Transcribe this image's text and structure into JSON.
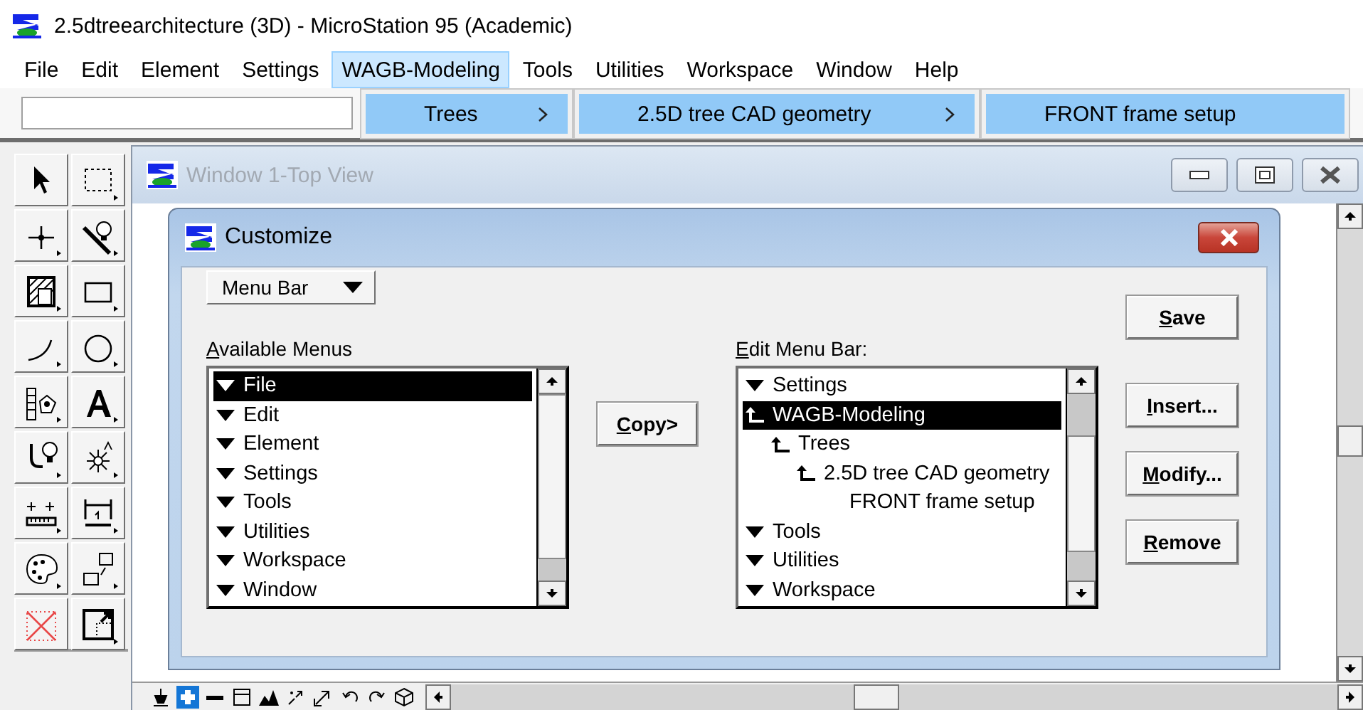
{
  "app": {
    "title": "2.5dtreearchitecture (3D) - MicroStation 95 (Academic)"
  },
  "menubar": [
    {
      "label": "File",
      "selected": false
    },
    {
      "label": "Edit",
      "selected": false
    },
    {
      "label": "Element",
      "selected": false
    },
    {
      "label": "Settings",
      "selected": false
    },
    {
      "label": "WAGB-Modeling",
      "selected": true
    },
    {
      "label": "Tools",
      "selected": false
    },
    {
      "label": "Utilities",
      "selected": false
    },
    {
      "label": "Workspace",
      "selected": false
    },
    {
      "label": "Window",
      "selected": false
    },
    {
      "label": "Help",
      "selected": false
    }
  ],
  "cascade": [
    {
      "label": "Trees",
      "has_submenu": true
    },
    {
      "label": "2.5D tree CAD geometry",
      "has_submenu": true
    },
    {
      "label": "FRONT frame setup",
      "has_submenu": false
    }
  ],
  "view_window": {
    "title": "Window 1-Top View",
    "active": false
  },
  "dialog": {
    "title": "Customize",
    "mnemonics": true,
    "dropdown": "Menu Bar",
    "available": {
      "label": "Available Menus",
      "items": [
        {
          "label": "File",
          "kind": "menu",
          "selected": true
        },
        {
          "label": "Edit",
          "kind": "menu",
          "selected": false
        },
        {
          "label": "Element",
          "kind": "menu",
          "selected": false
        },
        {
          "label": "Settings",
          "kind": "menu",
          "selected": false
        },
        {
          "label": "Tools",
          "kind": "menu",
          "selected": false
        },
        {
          "label": "Utilities",
          "kind": "menu",
          "selected": false
        },
        {
          "label": "Workspace",
          "kind": "menu",
          "selected": false
        },
        {
          "label": "Window",
          "kind": "menu",
          "selected": false
        }
      ]
    },
    "copy_button": "Copy>",
    "edit": {
      "label": "Edit Menu Bar:",
      "items": [
        {
          "label": "Settings",
          "kind": "menu",
          "selected": false
        },
        {
          "label": "WAGB-Modeling",
          "kind": "submenu",
          "selected": true,
          "children": [
            {
              "label": "Trees",
              "kind": "submenu",
              "selected": false,
              "children": [
                {
                  "label": "2.5D tree CAD geometry",
                  "kind": "submenu",
                  "selected": false,
                  "children": [
                    {
                      "label": "FRONT frame setup",
                      "kind": "item",
                      "selected": false
                    }
                  ]
                }
              ]
            }
          ]
        },
        {
          "label": "Tools",
          "kind": "menu",
          "selected": false
        },
        {
          "label": "Utilities",
          "kind": "menu",
          "selected": false
        },
        {
          "label": "Workspace",
          "kind": "menu",
          "selected": false
        }
      ]
    },
    "buttons": [
      "Save",
      "Insert...",
      "Modify...",
      "Remove"
    ]
  }
}
